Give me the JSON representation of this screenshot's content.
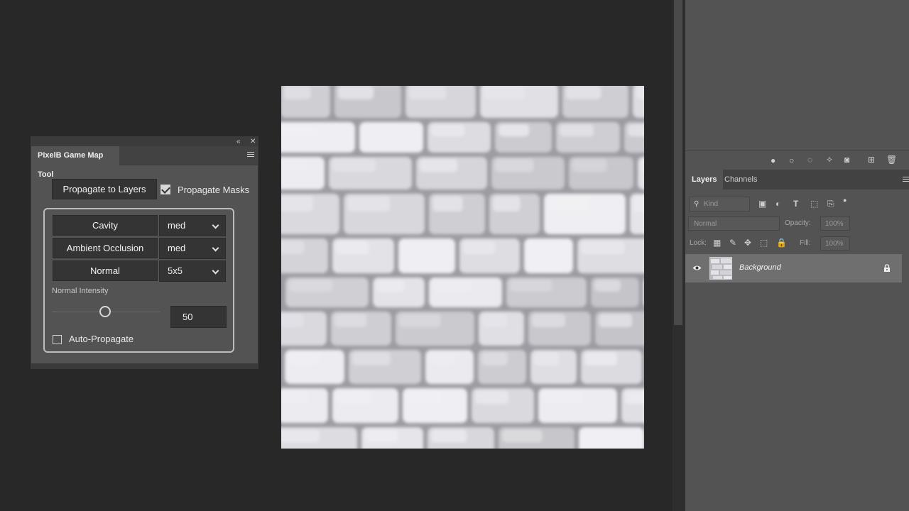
{
  "plugin": {
    "title": "PixelB Game Map Tool",
    "propagate_button": "Propagate to Layers",
    "propagate_masks_label": "Propagate Masks",
    "propagate_masks_checked": true,
    "maps": [
      {
        "label": "Cavity",
        "value": "med"
      },
      {
        "label": "Ambient Occlusion",
        "value": "med"
      },
      {
        "label": "Normal",
        "value": "5x5"
      }
    ],
    "normal_intensity_label": "Normal Intensity",
    "normal_intensity_value": "50",
    "auto_propagate_label": "Auto-Propagate",
    "auto_propagate_checked": false
  },
  "layers_panel": {
    "tabs": [
      "Layers",
      "Channels"
    ],
    "active_tab": "Layers",
    "filter_placeholder": "Kind",
    "blend_mode": "Normal",
    "opacity_label": "Opacity:",
    "opacity_value": "100%",
    "lock_label": "Lock:",
    "fill_label": "Fill:",
    "fill_value": "100%",
    "layers": [
      {
        "name": "Background",
        "visible": true,
        "locked": true
      }
    ]
  },
  "icons": {
    "collapse": "double-chevron-left-icon",
    "close": "close-icon",
    "menu": "hamburger-menu-icon",
    "cursor": "zoom-in-cursor-icon"
  }
}
